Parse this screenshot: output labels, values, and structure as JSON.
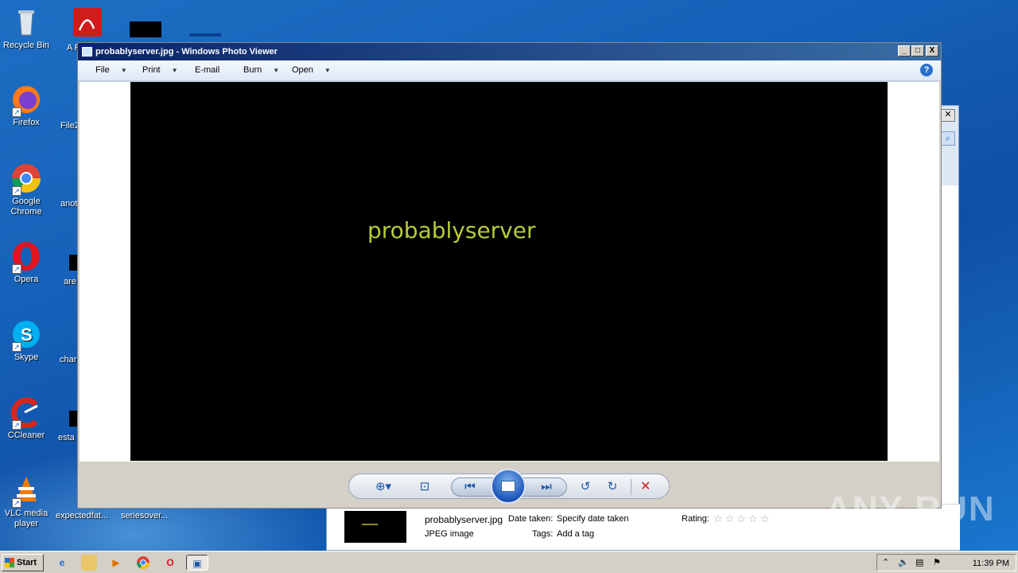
{
  "desktop": {
    "icons": [
      {
        "label": "Recycle Bin"
      },
      {
        "label": "Firefox"
      },
      {
        "label": "Google Chrome"
      },
      {
        "label": "Opera"
      },
      {
        "label": "Skype"
      },
      {
        "label": "CCleaner"
      },
      {
        "label": "VLC media player"
      }
    ],
    "second_column": [
      {
        "label": "A Re"
      },
      {
        "label": "File2"
      },
      {
        "label": "anot"
      },
      {
        "label": "are"
      },
      {
        "label": "char"
      },
      {
        "label": "esta"
      },
      {
        "label": "expectedfat..."
      },
      {
        "label": "seriesover..."
      }
    ]
  },
  "viewer": {
    "title": "probablyserver.jpg - Windows Photo Viewer",
    "menu": [
      "File",
      "Print",
      "E-mail",
      "Burn",
      "Open"
    ],
    "image_text": "probablyserver",
    "window_buttons": {
      "minimize": "_",
      "maximize": "□",
      "close": "X"
    }
  },
  "details": {
    "filename": "probablyserver.jpg",
    "filetype": "JPEG image",
    "date_label": "Date taken:",
    "date_value": "Specify date taken",
    "tags_label": "Tags:",
    "tags_value": "Add a tag",
    "rating_label": "Rating:",
    "rating_value": 0,
    "rating_max": 5
  },
  "watermark": "ANY RUN",
  "taskbar": {
    "start_label": "Start",
    "clock": "11:39 PM"
  },
  "colors": {
    "image_text": "#b8c93a",
    "title_bar_start": "#0a246a",
    "title_bar_end": "#3a6ea5",
    "delete": "#d02020"
  }
}
